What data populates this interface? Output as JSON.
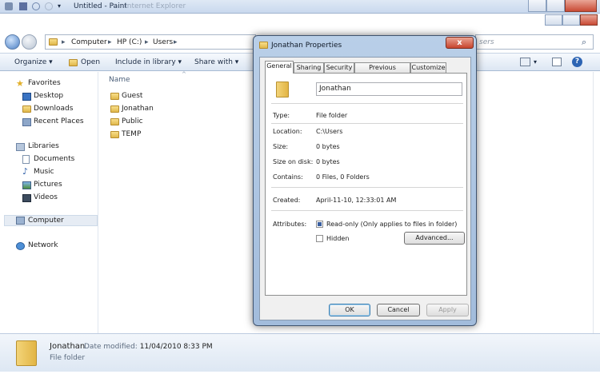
{
  "paint": {
    "title": "Untitled - Paint",
    "ghost_title": "- Internet Explorer"
  },
  "address": {
    "crumbs": [
      "Computer",
      "HP (C:)",
      "Users"
    ],
    "search_placeholder": "sers"
  },
  "toolbar": {
    "organize": "Organize ▾",
    "open": "Open",
    "include": "Include in library ▾",
    "share": "Share with ▾"
  },
  "nav": {
    "favorites": "Favorites",
    "desktop": "Desktop",
    "downloads": "Downloads",
    "recent": "Recent Places",
    "libraries": "Libraries",
    "documents": "Documents",
    "music": "Music",
    "pictures": "Pictures",
    "videos": "Videos",
    "computer": "Computer",
    "network": "Network"
  },
  "filelist": {
    "column_name": "Name",
    "items": [
      "Guest",
      "Jonathan",
      "Public",
      "TEMP"
    ]
  },
  "details": {
    "name": "Jonathan",
    "modified_label": "Date modified:",
    "modified_value": "11/04/2010 8:33 PM",
    "type": "File folder"
  },
  "dialog": {
    "title": "Jonathan Properties",
    "close": "x",
    "tabs": [
      "General",
      "Sharing",
      "Security",
      "Previous Versions",
      "Customize"
    ],
    "name_value": "Jonathan",
    "type_label": "Type:",
    "type_value": "File folder",
    "location_label": "Location:",
    "location_value": "C:\\Users",
    "size_label": "Size:",
    "size_value": "0 bytes",
    "size_disk_label": "Size on disk:",
    "size_disk_value": "0 bytes",
    "contains_label": "Contains:",
    "contains_value": "0 Files, 0 Folders",
    "created_label": "Created:",
    "created_value": "April-11-10, 12:33:01 AM",
    "attributes_label": "Attributes:",
    "readonly_label": "Read-only (Only applies to files in folder)",
    "hidden_label": "Hidden",
    "advanced": "Advanced...",
    "ok": "OK",
    "cancel": "Cancel",
    "apply": "Apply"
  }
}
